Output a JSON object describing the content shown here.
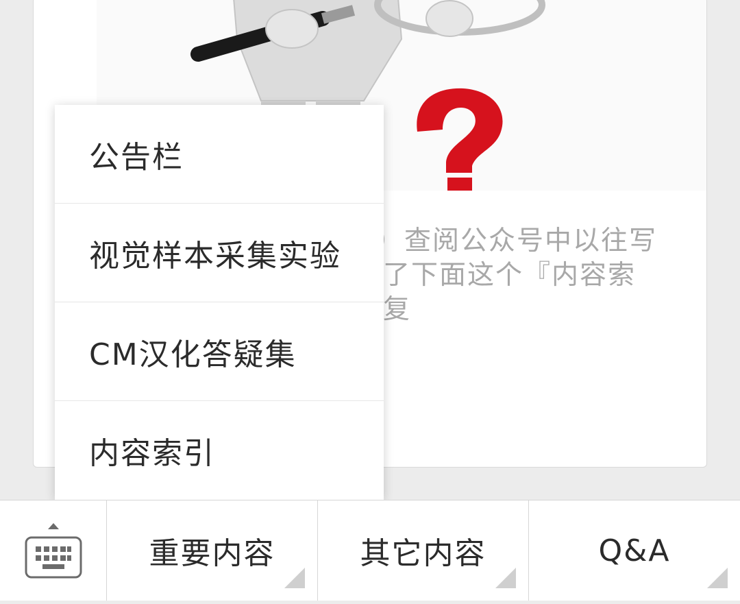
{
  "card": {
    "lines": [
      "）查阅公众号中以往写",
      "了下面这个『内容索",
      "复"
    ]
  },
  "menu": {
    "items": [
      {
        "label": "公告栏"
      },
      {
        "label": "视觉样本采集实验"
      },
      {
        "label": "CM汉化答疑集"
      },
      {
        "label": "内容索引"
      }
    ]
  },
  "bottom_bar": {
    "keyboard_icon": "keyboard-icon",
    "tabs": [
      {
        "label": "重要内容"
      },
      {
        "label": "其它内容"
      },
      {
        "label": "Q&A"
      }
    ]
  },
  "colors": {
    "accent_red": "#d6121d",
    "menu_text": "#2b2b2b",
    "muted_text": "#a8a8a8"
  }
}
